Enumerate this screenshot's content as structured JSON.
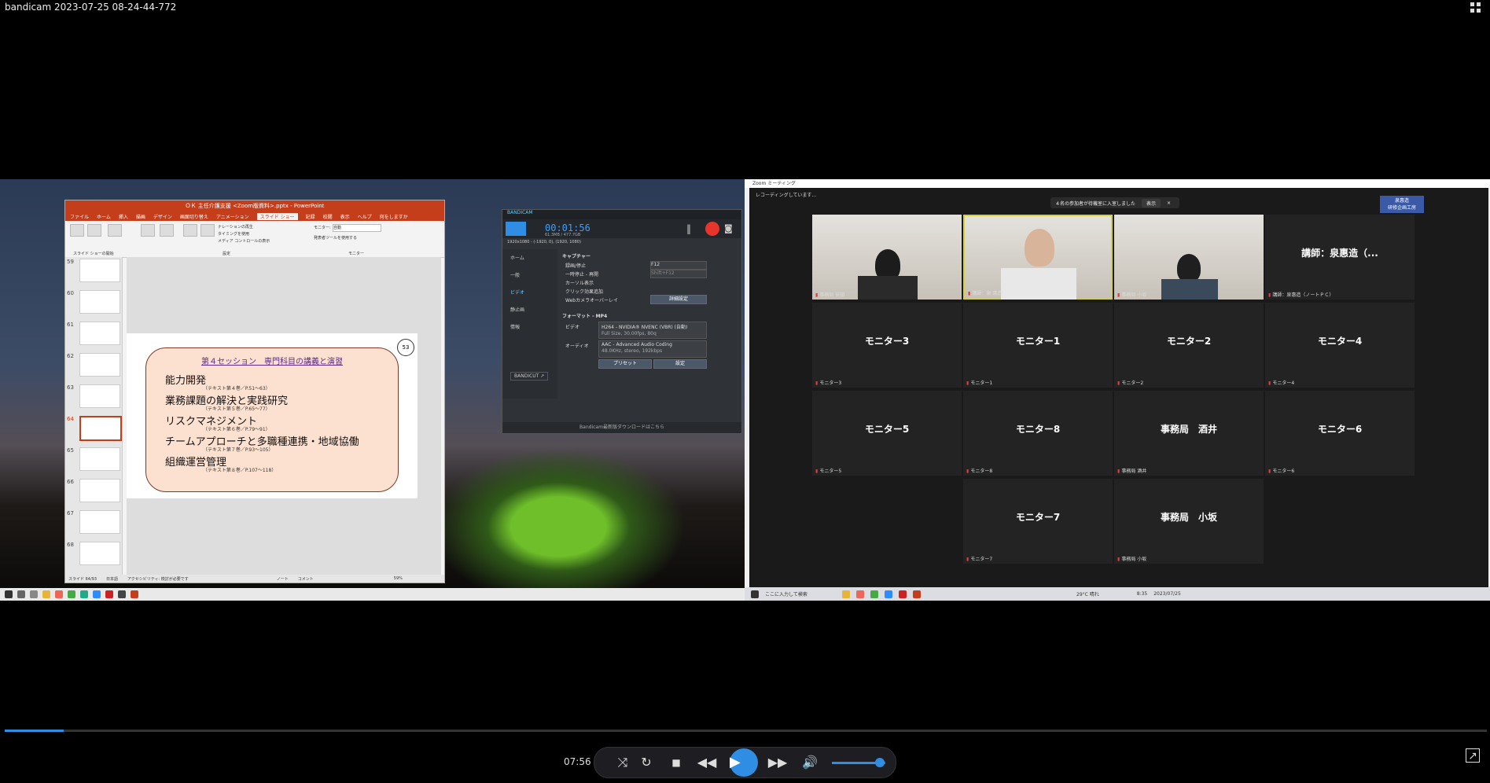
{
  "window": {
    "title": "bandicam 2023-07-25 08-24-44-772"
  },
  "powerpoint": {
    "title": "ＯＫ 主任介護支援 <Zoom版資料>.pptx - PowerPoint",
    "tabs": [
      "ファイル",
      "ホーム",
      "挿入",
      "描画",
      "デザイン",
      "画面切り替え",
      "アニメーション",
      "スライド ショー",
      "記録",
      "校閲",
      "表示",
      "ヘルプ",
      "何をしますか"
    ],
    "selected_tab": "スライド ショー",
    "ribbon_group_start": "スライド ショーの開始",
    "ribbon_group_settings": "設定",
    "ribbon_group_monitor": "モニター",
    "ribbon_checks": [
      "ナレーションの再生",
      "タイミングを使用",
      "メディア コントロールの表示"
    ],
    "monitor_label": "モニター:",
    "monitor_value": "自動",
    "presenter_check": "発表者ツールを使用する",
    "thumb_numbers": [
      "59",
      "60",
      "61",
      "62",
      "63",
      "64",
      "65",
      "66",
      "67",
      "68"
    ],
    "slide": {
      "heading": "第４セッション　専門科目の講義と演習",
      "page_number": "53",
      "lines": [
        "能力開発",
        "業務課題の解決と実践研究",
        "リスクマネジメント",
        "チームアプローチと多職種連携・地域協働",
        "組織運営管理"
      ],
      "subs": [
        "（テキスト第４巻／P.51～63）",
        "（テキスト第５巻／P.65～77）",
        "（テキスト第６巻／P.79～91）",
        "（テキスト第７巻／P.93～105）",
        "（テキスト第８巻／P.107～118）"
      ]
    },
    "status_slide": "スライド 64/93",
    "status_lang": "日本語",
    "status_access": "アクセシビリティ: 検討が必要です",
    "status_notes": "ノート",
    "status_comments": "コメント",
    "status_zoom": "59%"
  },
  "bandicam": {
    "brand": "BANDICAM",
    "time": "00:01:56",
    "size_info": "61.3MB / 477.7GB",
    "area": "1920x1080 - (-1920, 0), (1920, 1080)",
    "menu": [
      "ホーム",
      "一般",
      "ビデオ",
      "静止画",
      "情報"
    ],
    "capture_header": "キャプチャー",
    "options": [
      "録画/停止",
      "一時停止 - 再開",
      "カーソル表示",
      "クリック効果追加",
      "Webカメラオーバーレイ"
    ],
    "hotkey": "F12",
    "hotkey2": "Shift+F12",
    "detail_btn": "詳細設定",
    "format_header": "フォーマット - MP4",
    "video_label": "ビデオ",
    "video_value": "H264 - NVIDIA® NVENC (VBR) (自動)",
    "video_sub": "Full Size, 30.00fps, 80q",
    "audio_label": "オーディオ",
    "audio_value": "AAC - Advanced Audio Coding",
    "audio_sub": "48.0KHz, stereo, 192kbps",
    "preset_btn": "プリセット",
    "settings_btn": "設定",
    "bandicut": "BANDICUT ↗",
    "footer": "Bandicam最新版ダウンロードはこちら"
  },
  "zoom": {
    "title": "Zoom ミーティング",
    "recording": "レコーディングしています...",
    "notification": "４名の参加者が待機室に入室しました",
    "notification_btn": "表示",
    "logo": "泉惠造\n研修企画工房",
    "tiles": [
      {
        "name": "",
        "label": "事務局 安田"
      },
      {
        "name": "",
        "label": "講師：泉 惠造"
      },
      {
        "name": "",
        "label": "事務局 小坂"
      },
      {
        "name": "講師：泉惠造（...",
        "label": "講師：泉惠造（ノートＰＣ）"
      },
      {
        "name": "モニター3",
        "label": "モニター3"
      },
      {
        "name": "モニター1",
        "label": "モニター1"
      },
      {
        "name": "モニター2",
        "label": "モニター2"
      },
      {
        "name": "モニター4",
        "label": "モニター4"
      },
      {
        "name": "モニター5",
        "label": "モニター5"
      },
      {
        "name": "モニター8",
        "label": "モニター8"
      },
      {
        "name": "事務局　酒井",
        "label": "事務局 酒井"
      },
      {
        "name": "モニター6",
        "label": "モニター6"
      },
      {
        "name": "モニター7",
        "label": "モニター7"
      },
      {
        "name": "事務局　小坂",
        "label": "事務局 小坂"
      }
    ],
    "search_placeholder": "ここに入力して検索",
    "weather": "29°C 晴れ",
    "clock": "8:35",
    "date": "2023/07/25"
  },
  "player": {
    "current_time": "07:56",
    "progress_fraction": 0.04,
    "volume_fraction": 0.9
  }
}
